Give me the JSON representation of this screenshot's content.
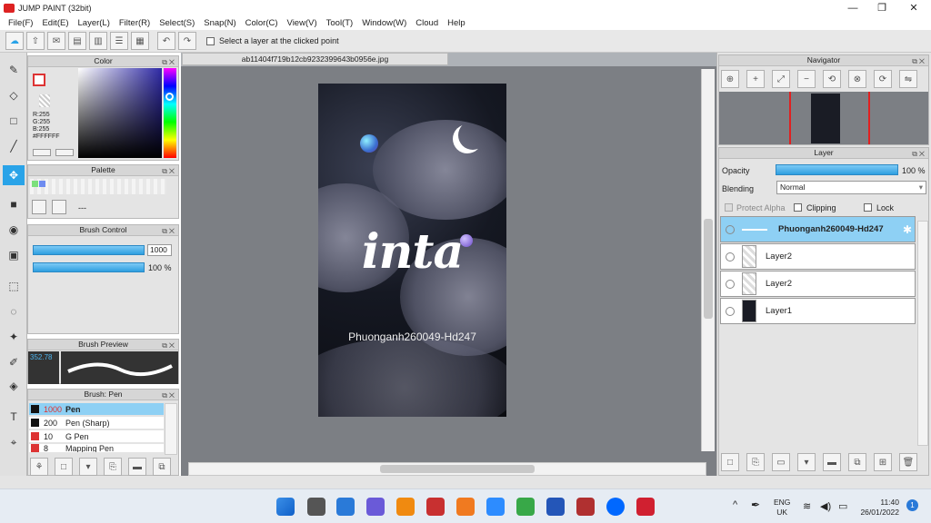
{
  "window": {
    "title": "JUMP PAINT (32bit)",
    "min": "—",
    "max": "❐",
    "close": "✕"
  },
  "menu": [
    "File(F)",
    "Edit(E)",
    "Layer(L)",
    "Filter(R)",
    "Select(S)",
    "Snap(N)",
    "Color(C)",
    "View(V)",
    "Tool(T)",
    "Window(W)",
    "Cloud",
    "Help"
  ],
  "toolbar": {
    "select_layer_label": "Select a layer at the clicked point"
  },
  "color_panel": {
    "title": "Color",
    "r": "R:255",
    "g": "G:255",
    "b": "B:255",
    "hex": "#FFFFFF",
    "accent": "#2f2aa6"
  },
  "palette_panel": {
    "title": "Palette",
    "dash": "---"
  },
  "brush_control": {
    "title": "Brush Control",
    "size_value": "1000",
    "opacity_value": "100 %"
  },
  "brush_preview": {
    "title": "Brush Preview",
    "size": "352.78"
  },
  "brush_list": {
    "title": "Brush: Pen",
    "items": [
      {
        "size": "1000",
        "name": "Pen"
      },
      {
        "size": "200",
        "name": "Pen (Sharp)"
      },
      {
        "size": "10",
        "name": "G Pen"
      },
      {
        "size": "8",
        "name": "Mapping Pen"
      }
    ]
  },
  "document": {
    "tab": "ab11404f719b12cb9232399643b0956e.jpg",
    "art_title": "inta",
    "art_subtitle": "Phuonganh260049-Hd247"
  },
  "navigator": {
    "title": "Navigator"
  },
  "layer_panel": {
    "title": "Layer",
    "opacity_label": "Opacity",
    "opacity_value": "100 %",
    "blending_label": "Blending",
    "blending_value": "Normal",
    "protect_alpha": "Protect Alpha",
    "clipping": "Clipping",
    "lock": "Lock",
    "layers": [
      {
        "name": "Phuonganh260049-Hd247"
      },
      {
        "name": "Layer2"
      },
      {
        "name": "Layer2"
      },
      {
        "name": "Layer1"
      }
    ]
  },
  "taskbar": {
    "lang1": "ENG",
    "lang2": "UK",
    "time": "11:40",
    "date": "26/01/2022",
    "badge": "1"
  }
}
